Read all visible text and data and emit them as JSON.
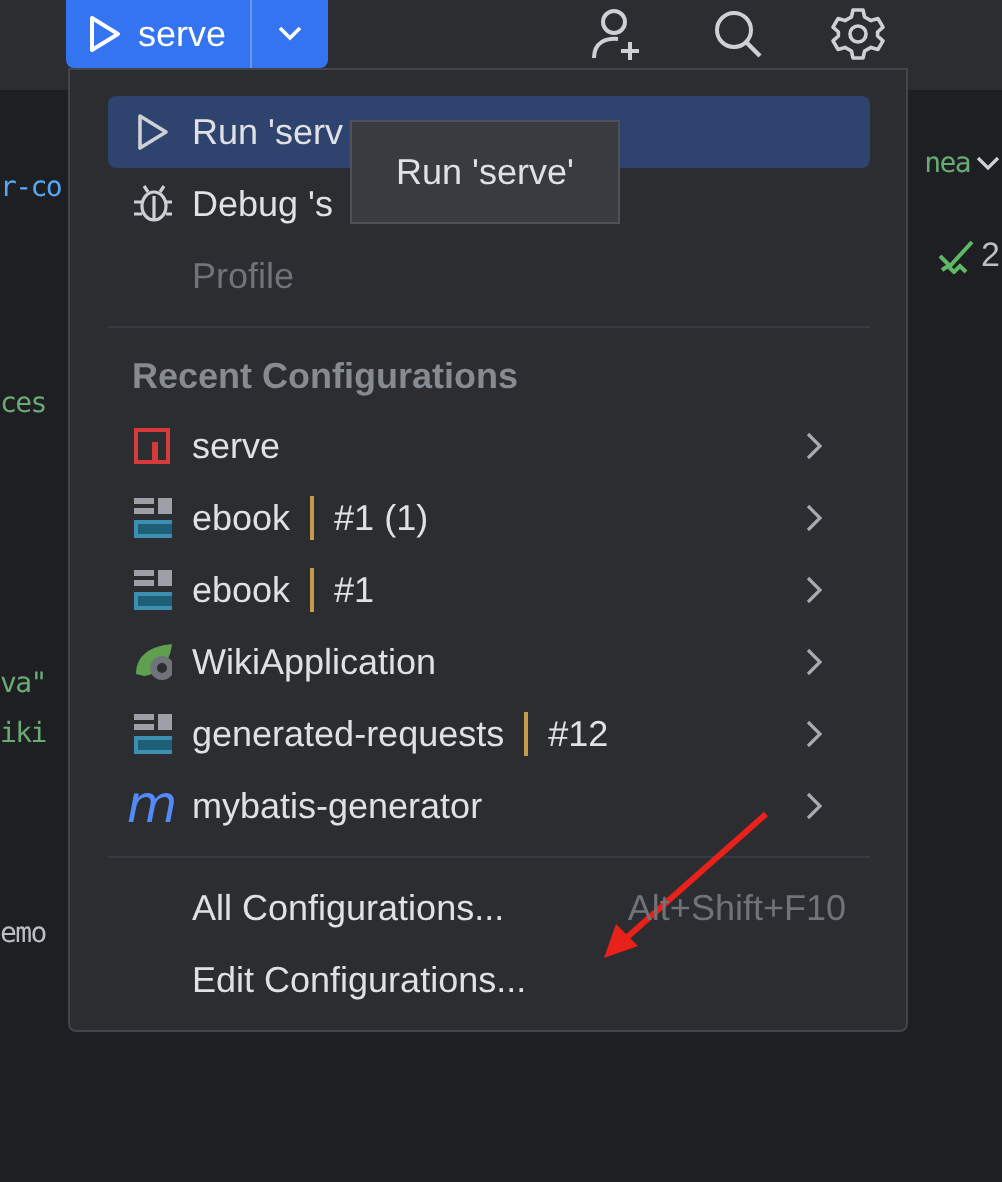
{
  "toolbar": {
    "run_button": {
      "label": "serve"
    }
  },
  "editor": {
    "left_fragments": [
      {
        "text": "r-co",
        "kind": "keyword"
      },
      {
        "text": "ces",
        "kind": "string"
      },
      {
        "text": "va\"",
        "kind": "string"
      },
      {
        "text": "iki",
        "kind": "string"
      },
      {
        "text": "emo",
        "kind": "plain"
      }
    ],
    "right_fragments": [
      {
        "text": "nea",
        "kind": "string"
      }
    ],
    "problems": {
      "count": "2"
    }
  },
  "menu": {
    "actions": [
      {
        "label": "Run 'serv",
        "kind": "run",
        "selected": true,
        "disabled": false
      },
      {
        "label": "Debug 's",
        "kind": "debug",
        "selected": false,
        "disabled": false
      },
      {
        "label": "Profile",
        "kind": "none",
        "selected": false,
        "disabled": true
      }
    ],
    "recent_header": "Recent Configurations",
    "recent": [
      {
        "name": "serve",
        "kind": "stop"
      },
      {
        "name": "ebook",
        "suffix": "#1 (1)",
        "kind": "api"
      },
      {
        "name": "ebook",
        "suffix": "#1",
        "kind": "api"
      },
      {
        "name": "WikiApplication",
        "kind": "spring"
      },
      {
        "name": "generated-requests",
        "suffix": "#12",
        "kind": "api"
      },
      {
        "name": "mybatis-generator",
        "kind": "glyph",
        "glyph": "m"
      }
    ],
    "footer": [
      {
        "label": "All Configurations...",
        "shortcut": "Alt+Shift+F10"
      },
      {
        "label": "Edit Configurations..."
      }
    ]
  },
  "tooltip": {
    "text": "Run 'serve'"
  }
}
